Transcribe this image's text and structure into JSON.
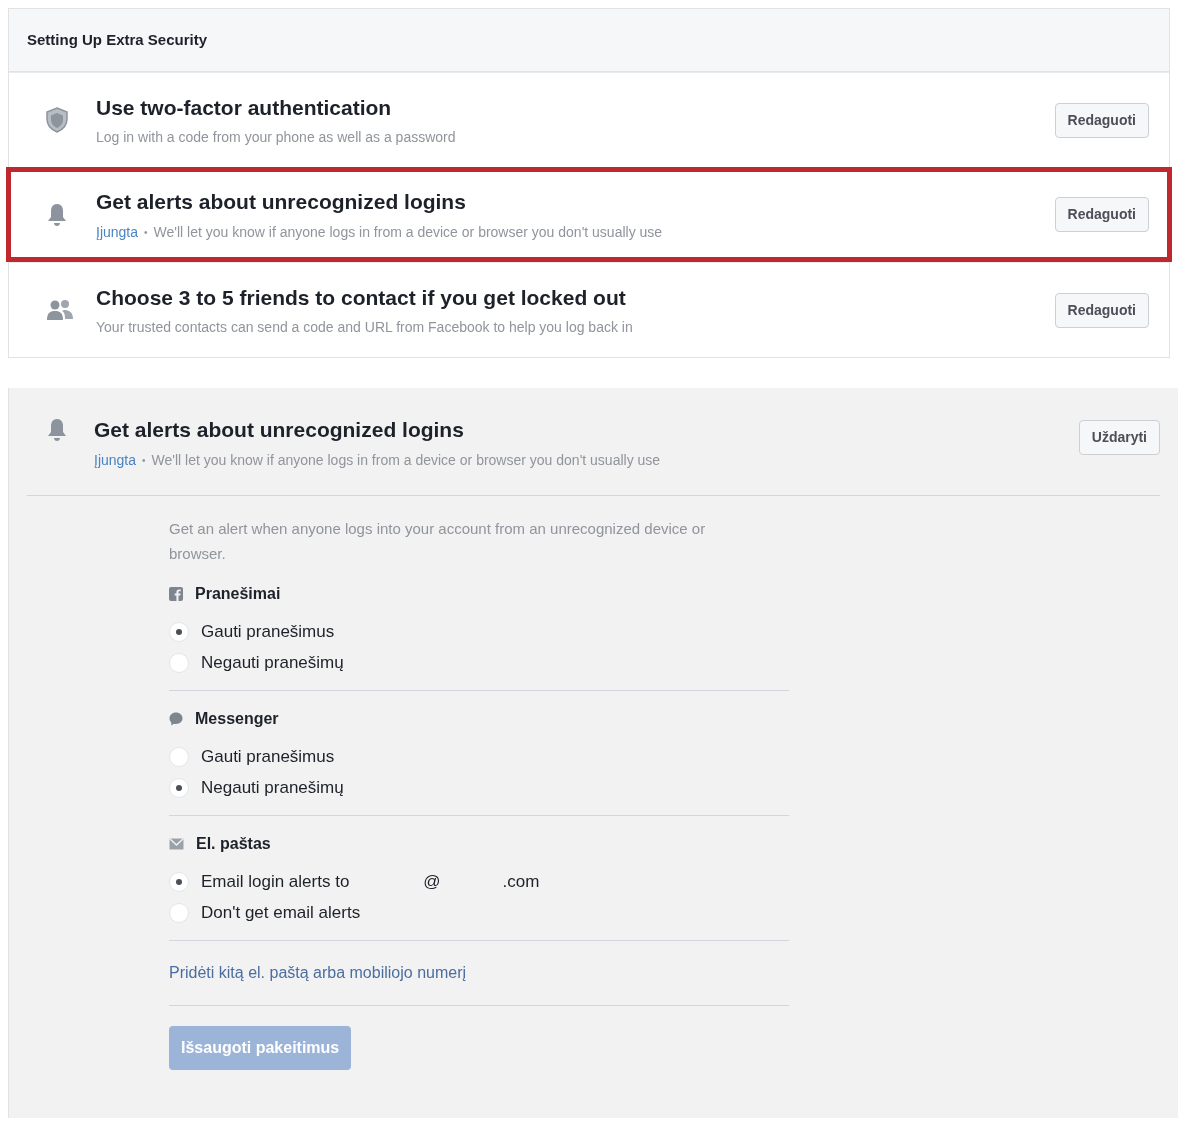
{
  "section": {
    "title": "Setting Up Extra Security",
    "rows": [
      {
        "kind": "shield",
        "title": "Use two-factor authentication",
        "description": "Log in with a code from your phone as well as a password",
        "button": "Redaguoti",
        "highlighted": false
      },
      {
        "kind": "bell",
        "title": "Get alerts about unrecognized logins",
        "status": "Įjungta",
        "separator": "•",
        "description": "We'll let you know if anyone logs in from a device or browser you don't usually use",
        "button": "Redaguoti",
        "highlighted": true
      },
      {
        "kind": "people",
        "title": "Choose 3 to 5 friends to contact if you get locked out",
        "description": "Your trusted contacts can send a code and URL from Facebook to help you log back in",
        "button": "Redaguoti",
        "highlighted": false
      }
    ]
  },
  "expanded_panel": {
    "title": "Get alerts about unrecognized logins",
    "status": "Įjungta",
    "separator": "•",
    "description": "We'll let you know if anyone logs in from a device or browser you don't usually use",
    "close_button": "Uždaryti",
    "intro": "Get an alert when anyone logs into your account from an unrecognized device or browser.",
    "groups": [
      {
        "kind": "facebook",
        "title": "Pranešimai",
        "options": [
          {
            "label": "Gauti pranešimus",
            "selected": true
          },
          {
            "label": "Negauti pranešimų",
            "selected": false
          }
        ]
      },
      {
        "kind": "messenger",
        "title": "Messenger",
        "options": [
          {
            "label": "Gauti pranešimus",
            "selected": false
          },
          {
            "label": "Negauti pranešimų",
            "selected": true
          }
        ]
      },
      {
        "kind": "email",
        "title": "El. paštas",
        "options": [
          {
            "label": "Email login alerts to",
            "address_parts": [
              "@",
              ".com"
            ],
            "selected": true
          },
          {
            "label": "Don't get email alerts",
            "selected": false
          }
        ]
      }
    ],
    "add_link": "Pridėti kitą el. paštą arba mobiliojo numerį",
    "save_button": {
      "label": "Išsaugoti pakeitimus",
      "disabled": true
    }
  }
}
